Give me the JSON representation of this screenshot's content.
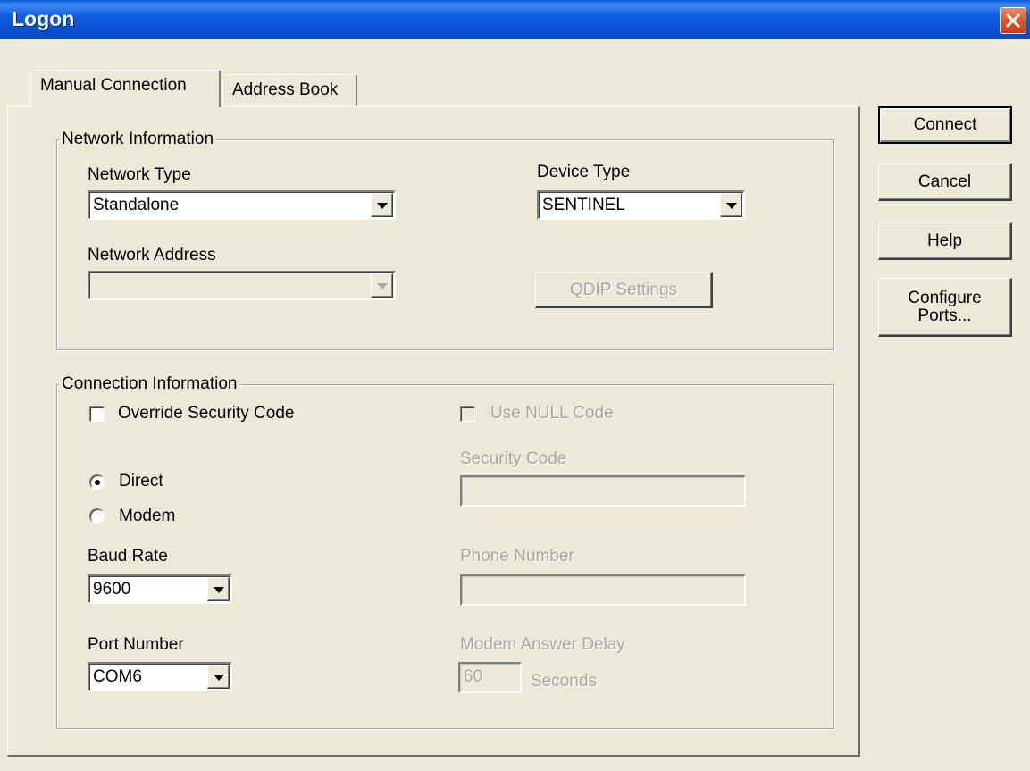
{
  "window": {
    "title": "Logon"
  },
  "tabs": [
    {
      "label": "Manual Connection",
      "active": true
    },
    {
      "label": "Address Book",
      "active": false
    }
  ],
  "network_info": {
    "legend": "Network Information",
    "network_type_label": "Network Type",
    "network_type_value": "Standalone",
    "device_type_label": "Device Type",
    "device_type_value": "SENTINEL",
    "network_address_label": "Network Address",
    "network_address_value": "",
    "qdip_button": "QDIP Settings"
  },
  "connection_info": {
    "legend": "Connection Information",
    "override_security_label": "Override Security Code",
    "use_null_label": "Use NULL Code",
    "security_code_label": "Security Code",
    "security_code_value": "",
    "direct_label": "Direct",
    "modem_label": "Modem",
    "baud_rate_label": "Baud Rate",
    "baud_rate_value": "9600",
    "phone_number_label": "Phone Number",
    "phone_number_value": "",
    "port_number_label": "Port Number",
    "port_number_value": "COM6",
    "modem_delay_label": "Modem Answer Delay",
    "modem_delay_value": "60",
    "seconds_label": "Seconds"
  },
  "buttons": {
    "connect": "Connect",
    "cancel": "Cancel",
    "help": "Help",
    "configure_line1": "Configure",
    "configure_line2": "Ports..."
  },
  "colors": {
    "titlebar": "#0a4fd0",
    "face": "#ece9d8",
    "close": "#d85a32",
    "disabled_text": "#a9a6a0"
  }
}
